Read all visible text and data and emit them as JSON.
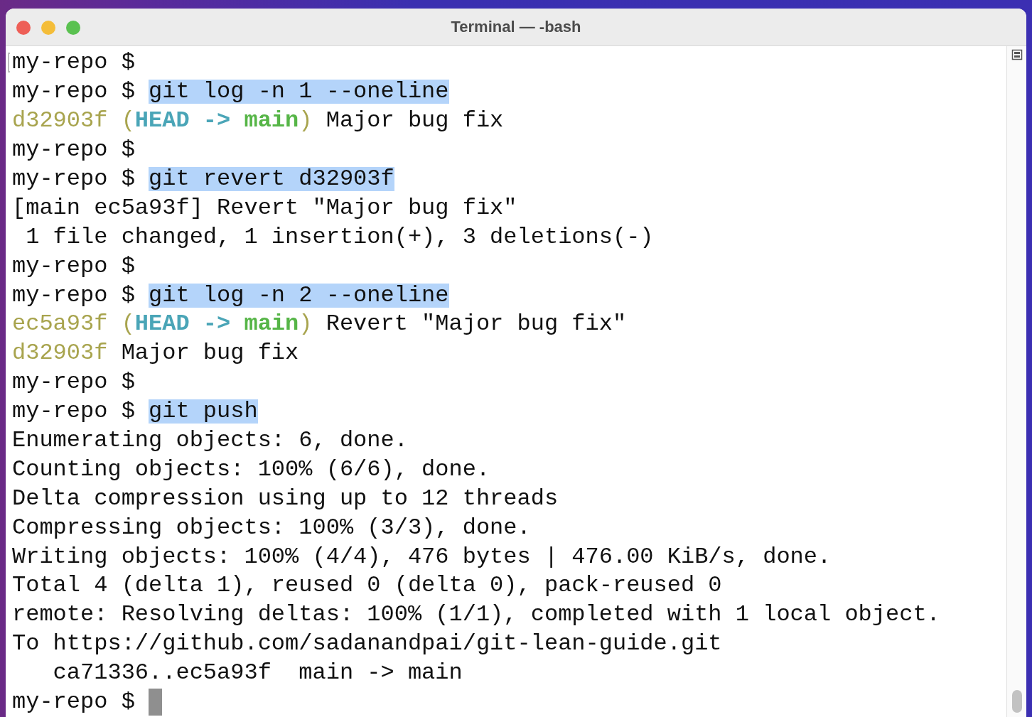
{
  "window": {
    "title": "Terminal — -bash"
  },
  "lines": [
    {
      "marked": true,
      "segments": [
        {
          "kind": "prompt",
          "text": "my-repo $"
        }
      ]
    },
    {
      "marked": false,
      "segments": [
        {
          "kind": "prompt",
          "text": "my-repo $ "
        },
        {
          "kind": "command",
          "text": "git log -n 1 --oneline"
        }
      ]
    },
    {
      "marked": false,
      "segments": [
        {
          "kind": "hash",
          "text": "d32903f ("
        },
        {
          "kind": "head",
          "text": "HEAD -> "
        },
        {
          "kind": "branch",
          "text": "main"
        },
        {
          "kind": "hash",
          "text": ")"
        },
        {
          "kind": "text",
          "text": " Major bug fix"
        }
      ]
    },
    {
      "marked": false,
      "segments": [
        {
          "kind": "prompt",
          "text": "my-repo $"
        }
      ]
    },
    {
      "marked": false,
      "segments": [
        {
          "kind": "prompt",
          "text": "my-repo $ "
        },
        {
          "kind": "command",
          "text": "git revert d32903f"
        }
      ]
    },
    {
      "marked": false,
      "segments": [
        {
          "kind": "text",
          "text": "[main ec5a93f] Revert \"Major bug fix\""
        }
      ]
    },
    {
      "marked": false,
      "segments": [
        {
          "kind": "text",
          "text": " 1 file changed, 1 insertion(+), 3 deletions(-)"
        }
      ]
    },
    {
      "marked": false,
      "segments": [
        {
          "kind": "prompt",
          "text": "my-repo $"
        }
      ]
    },
    {
      "marked": false,
      "segments": [
        {
          "kind": "prompt",
          "text": "my-repo $ "
        },
        {
          "kind": "command",
          "text": "git log -n 2 --oneline"
        }
      ]
    },
    {
      "marked": false,
      "segments": [
        {
          "kind": "hash",
          "text": "ec5a93f ("
        },
        {
          "kind": "head",
          "text": "HEAD -> "
        },
        {
          "kind": "branch",
          "text": "main"
        },
        {
          "kind": "hash",
          "text": ")"
        },
        {
          "kind": "text",
          "text": " Revert \"Major bug fix\""
        }
      ]
    },
    {
      "marked": false,
      "segments": [
        {
          "kind": "hash",
          "text": "d32903f"
        },
        {
          "kind": "text",
          "text": " Major bug fix"
        }
      ]
    },
    {
      "marked": false,
      "segments": [
        {
          "kind": "prompt",
          "text": "my-repo $"
        }
      ]
    },
    {
      "marked": false,
      "segments": [
        {
          "kind": "prompt",
          "text": "my-repo $ "
        },
        {
          "kind": "command",
          "text": "git push"
        }
      ]
    },
    {
      "marked": false,
      "segments": [
        {
          "kind": "text",
          "text": "Enumerating objects: 6, done."
        }
      ]
    },
    {
      "marked": false,
      "segments": [
        {
          "kind": "text",
          "text": "Counting objects: 100% (6/6), done."
        }
      ]
    },
    {
      "marked": false,
      "segments": [
        {
          "kind": "text",
          "text": "Delta compression using up to 12 threads"
        }
      ]
    },
    {
      "marked": false,
      "segments": [
        {
          "kind": "text",
          "text": "Compressing objects: 100% (3/3), done."
        }
      ]
    },
    {
      "marked": false,
      "segments": [
        {
          "kind": "text",
          "text": "Writing objects: 100% (4/4), 476 bytes | 476.00 KiB/s, done."
        }
      ]
    },
    {
      "marked": false,
      "segments": [
        {
          "kind": "text",
          "text": "Total 4 (delta 1), reused 0 (delta 0), pack-reused 0"
        }
      ]
    },
    {
      "marked": false,
      "segments": [
        {
          "kind": "text",
          "text": "remote: Resolving deltas: 100% (1/1), completed with 1 local object."
        }
      ]
    },
    {
      "marked": false,
      "segments": [
        {
          "kind": "text",
          "text": "To https://github.com/sadanandpai/git-lean-guide.git"
        }
      ]
    },
    {
      "marked": false,
      "segments": [
        {
          "kind": "text",
          "text": "   ca71336..ec5a93f  main -> main"
        }
      ]
    },
    {
      "marked": false,
      "segments": [
        {
          "kind": "prompt",
          "text": "my-repo $ "
        },
        {
          "kind": "cursor"
        }
      ]
    }
  ]
}
